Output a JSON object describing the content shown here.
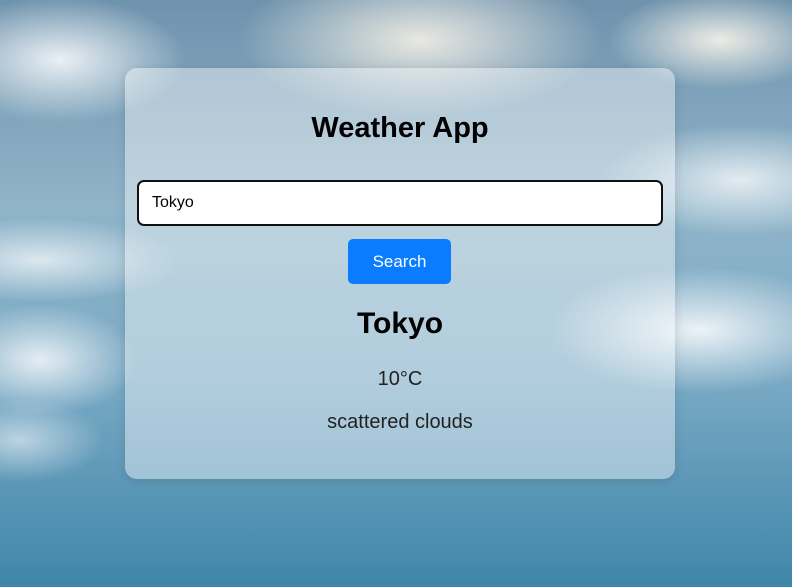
{
  "app": {
    "title": "Weather App"
  },
  "search": {
    "value": "Tokyo",
    "button_label": "Search"
  },
  "result": {
    "city": "Tokyo",
    "temperature": "10°C",
    "description": "scattered clouds"
  }
}
